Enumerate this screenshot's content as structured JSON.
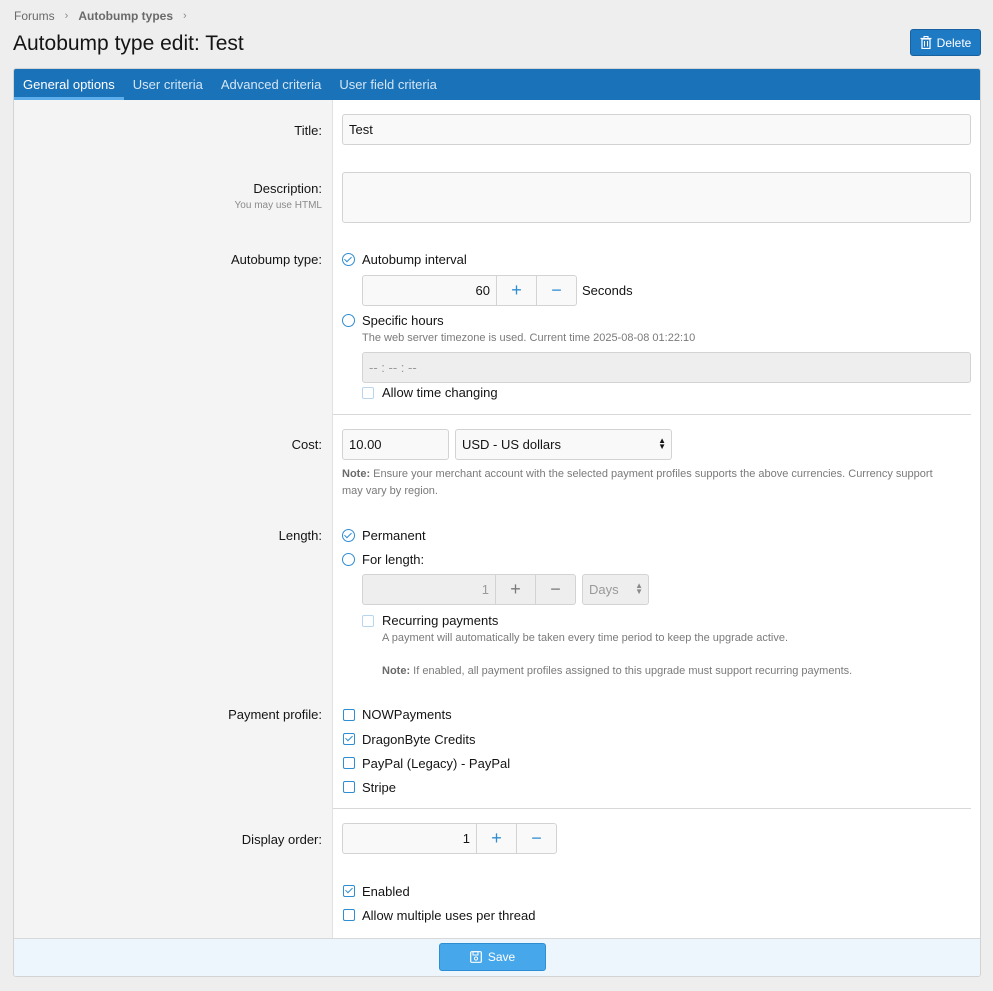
{
  "breadcrumb": {
    "items": [
      "Forums",
      "Autobump types"
    ]
  },
  "page_title": "Autobump type edit: Test",
  "delete_label": "Delete",
  "tabs": [
    "General options",
    "User criteria",
    "Advanced criteria",
    "User field criteria"
  ],
  "form": {
    "title": {
      "label": "Title:",
      "value": "Test"
    },
    "description": {
      "label": "Description:",
      "hint": "You may use HTML",
      "value": ""
    },
    "autobump_type": {
      "label": "Autobump type:",
      "interval_label": "Autobump interval",
      "interval_value": "60",
      "interval_unit": "Seconds",
      "specific_label": "Specific hours",
      "specific_hint": "The web server timezone is used. Current time 2025-08-08 01:22:10",
      "time_placeholder": "-- : -- : --",
      "allow_time_changing": "Allow time changing"
    },
    "cost": {
      "label": "Cost:",
      "value": "10.00",
      "currency": "USD - US dollars",
      "note_bold": "Note:",
      "note_text": " Ensure your merchant account with the selected payment profiles supports the above currencies. Currency support",
      "note_text2": "may vary by region."
    },
    "length": {
      "label": "Length:",
      "permanent": "Permanent",
      "for_length": "For length:",
      "length_value": "1",
      "length_unit": "Days",
      "recurring": "Recurring payments",
      "recurring_hint": "A payment will automatically be taken every time period to keep the upgrade active.",
      "recurring_note_bold": "Note:",
      "recurring_note": " If enabled, all payment profiles assigned to this upgrade must support recurring payments."
    },
    "payment_profile": {
      "label": "Payment profile:",
      "options": [
        {
          "label": "NOWPayments",
          "checked": false
        },
        {
          "label": "DragonByte Credits",
          "checked": true
        },
        {
          "label": "PayPal (Legacy) - PayPal",
          "checked": false
        },
        {
          "label": "Stripe",
          "checked": false
        }
      ]
    },
    "display_order": {
      "label": "Display order:",
      "value": "1"
    },
    "enabled": "Enabled",
    "allow_multiple": "Allow multiple uses per thread"
  },
  "save_label": "Save",
  "colors": {
    "accent": "#1a72b8",
    "button": "#47a7eb",
    "check": "#2f8dd3"
  }
}
